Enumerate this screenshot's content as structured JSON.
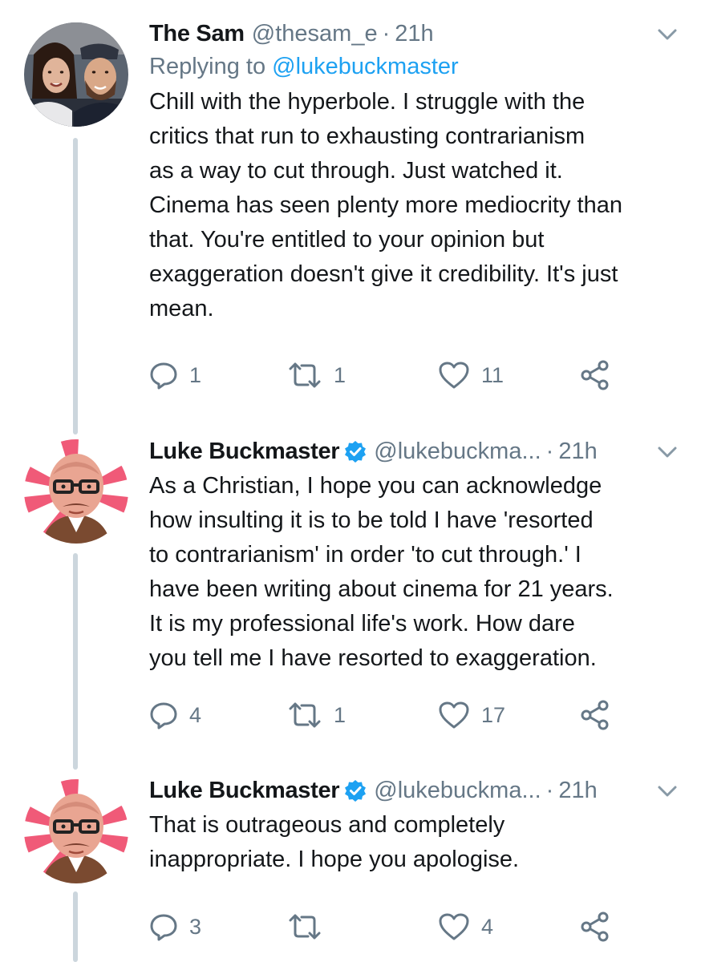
{
  "tweets": [
    {
      "display_name": "The Sam",
      "handle": "@thesam_e",
      "dot": "·",
      "time": "21h",
      "verified": false,
      "replying_prefix": "Replying to ",
      "replying_to": "@lukebuckmaster",
      "lines": [
        "Chill with the hyperbole. I struggle with the",
        "critics that run to exhausting contrarianism",
        "as a way to cut through. Just watched it.",
        "Cinema has seen plenty more mediocrity than",
        "that. You're entitled to your opinion but",
        "exaggeration doesn't give it credibility. It's just",
        "mean."
      ],
      "replies": "1",
      "retweets": "1",
      "likes": "11"
    },
    {
      "display_name": "Luke Buckmaster",
      "handle": "@lukebuckma...",
      "dot": "·",
      "time": "21h",
      "verified": true,
      "lines": [
        "As a Christian, I hope you can acknowledge",
        "how insulting it is to be told I have 'resorted",
        "to contrarianism' in order 'to cut through.' I",
        "have been writing about cinema for 21 years.",
        "It is my professional life's work. How dare",
        "you tell me I have resorted to exaggeration."
      ],
      "replies": "4",
      "retweets": "1",
      "likes": "17"
    },
    {
      "display_name": "Luke Buckmaster",
      "handle": "@lukebuckma...",
      "dot": "·",
      "time": "21h",
      "verified": true,
      "lines": [
        "That is outrageous and completely",
        "inappropriate. I hope you apologise."
      ],
      "replies": "3",
      "retweets": "",
      "likes": "4"
    }
  ],
  "icons": {
    "reply": "reply-icon",
    "retweet": "retweet-icon",
    "like": "heart-icon",
    "share": "share-icon",
    "menu": "chevron-down-icon",
    "verified": "verified-badge-icon"
  },
  "colors": {
    "text": "#14171a",
    "secondary": "#657786",
    "link": "#1da1f2",
    "thread_line": "#ccd6dd"
  }
}
